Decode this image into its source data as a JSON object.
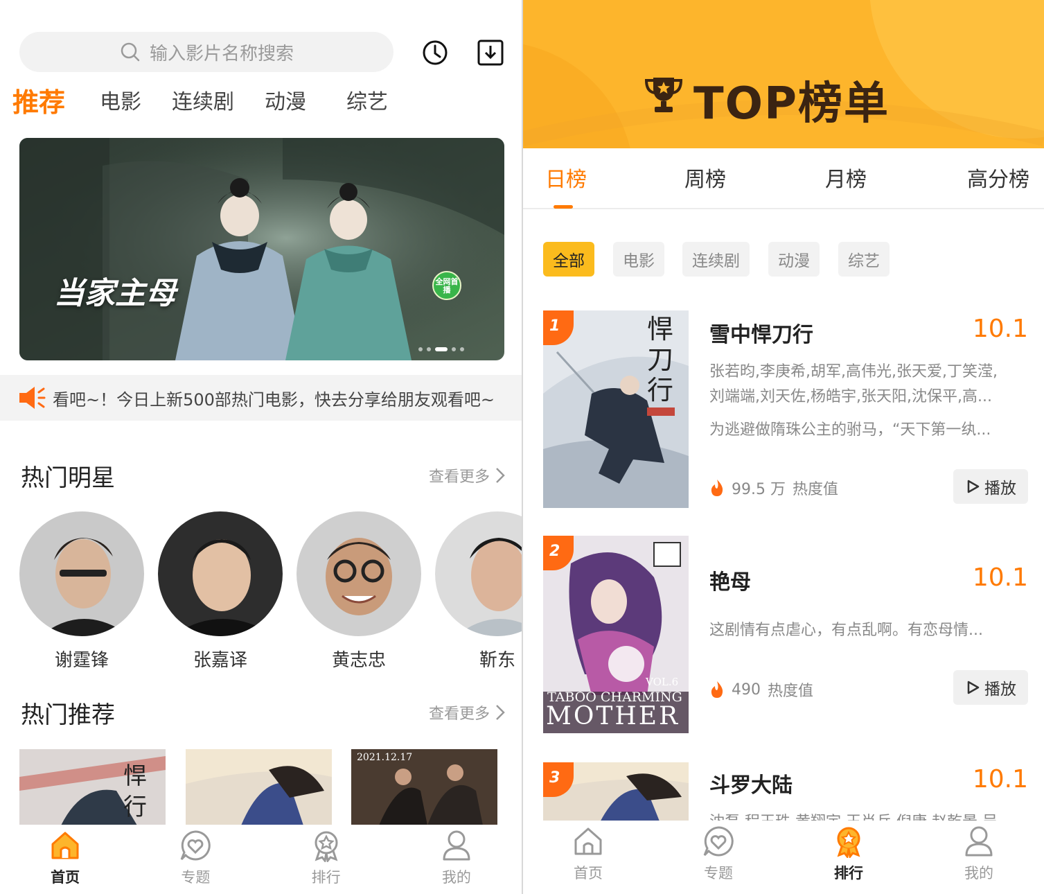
{
  "home": {
    "search": {
      "placeholder": "输入影片名称搜索"
    },
    "categories": [
      "推荐",
      "电影",
      "连续剧",
      "动漫",
      "综艺"
    ],
    "banner": {
      "title": "当家主母",
      "badge": "全网首播"
    },
    "notice": "看吧~！今日上新500部热门电影，快去分享给朋友观看吧~",
    "hot_stars": {
      "title": "热门明星",
      "more": "查看更多",
      "items": [
        {
          "name": "谢霆锋"
        },
        {
          "name": "张嘉译"
        },
        {
          "name": "黄志忠"
        },
        {
          "name": "靳东"
        }
      ]
    },
    "hot_rec": {
      "title": "热门推荐",
      "more": "查看更多",
      "poster3_date": "2021.12.17"
    },
    "nav": [
      {
        "label": "首页",
        "icon": "home-icon",
        "active": true
      },
      {
        "label": "专题",
        "icon": "heart-chat-icon",
        "active": false
      },
      {
        "label": "排行",
        "icon": "award-icon",
        "active": false
      },
      {
        "label": "我的",
        "icon": "user-icon",
        "active": false
      }
    ]
  },
  "ranking": {
    "header_title": "TOP榜单",
    "tabs": [
      "日榜",
      "周榜",
      "月榜",
      "高分榜"
    ],
    "filters": [
      "全部",
      "电影",
      "连续剧",
      "动漫",
      "综艺"
    ],
    "items": [
      {
        "rank": "1",
        "title": "雪中悍刀行",
        "score": "10.1",
        "cast": "张若昀,李庚希,胡军,高伟光,张天爱,丁笑滢,",
        "cast2": "刘端端,刘天佐,杨皓宇,张天阳,沈保平,高...",
        "desc": "为逃避做隋珠公主的驸马，“天下第一纨...",
        "heat": "99.5 万",
        "heat_label": "热度值",
        "play": "播放"
      },
      {
        "rank": "2",
        "title": "艳母",
        "score": "10.1",
        "desc": "这剧情有点虐心，有点乱啊。有恋母情...",
        "heat": "490",
        "heat_label": "热度值",
        "play": "播放",
        "poster_text_1": "VOL.6",
        "poster_text_2": "TABOO CHARMING",
        "poster_text_3": "MOTHER"
      },
      {
        "rank": "3",
        "title": "斗罗大陆",
        "score": "10.1",
        "cast": "沈磊,程玉珠,黄翔宇,王肖兵,倪康,赵乾景,吴"
      }
    ],
    "nav": [
      {
        "label": "首页",
        "icon": "home-icon",
        "active": false
      },
      {
        "label": "专题",
        "icon": "heart-chat-icon",
        "active": false
      },
      {
        "label": "排行",
        "icon": "award-icon",
        "active": true
      },
      {
        "label": "我的",
        "icon": "user-icon",
        "active": false
      }
    ]
  },
  "colors": {
    "accent": "#ff7a00",
    "header_yellow": "#fdb52c",
    "chip_active": "#fbbb1d"
  }
}
